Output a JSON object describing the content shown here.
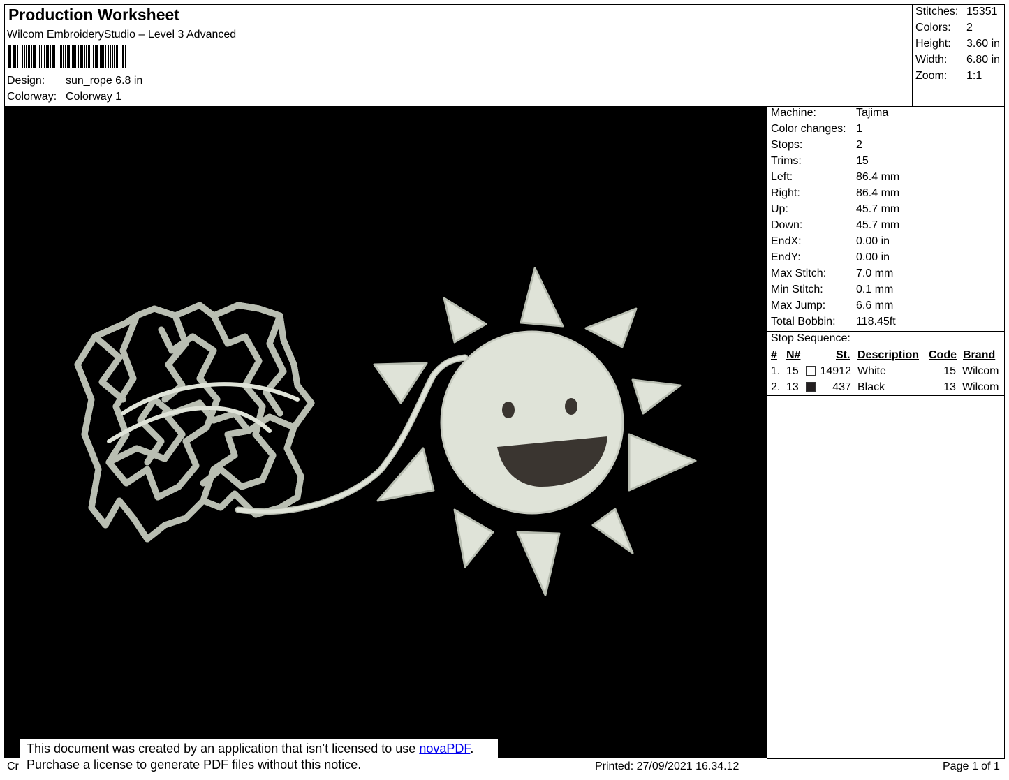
{
  "header": {
    "title": "Production Worksheet",
    "software": "Wilcom EmbroideryStudio – Level 3 Advanced",
    "design_label": "Design:",
    "design_value": "sun_rope 6.8 in",
    "colorway_label": "Colorway:",
    "colorway_value": "Colorway 1"
  },
  "stats": {
    "stitches_label": "Stitches:",
    "stitches": "15351",
    "colors_label": "Colors:",
    "colors": "2",
    "height_label": "Height:",
    "height": "3.60 in",
    "width_label": "Width:",
    "width": "6.80 in",
    "zoom_label": "Zoom:",
    "zoom": "1:1"
  },
  "machine_info": [
    {
      "label": "Machine:",
      "value": "Tajima"
    },
    {
      "label": "Color changes:",
      "value": "1"
    },
    {
      "label": "Stops:",
      "value": "2"
    },
    {
      "label": "Trims:",
      "value": "15"
    },
    {
      "label": "Left:",
      "value": "86.4 mm"
    },
    {
      "label": "Right:",
      "value": "86.4 mm"
    },
    {
      "label": "Up:",
      "value": "45.7 mm"
    },
    {
      "label": "Down:",
      "value": "45.7 mm"
    },
    {
      "label": "EndX:",
      "value": "0.00 in"
    },
    {
      "label": "EndY:",
      "value": "0.00 in"
    },
    {
      "label": "Max Stitch:",
      "value": "7.0 mm"
    },
    {
      "label": "Min Stitch:",
      "value": "0.1 mm"
    },
    {
      "label": "Max Jump:",
      "value": "6.6 mm"
    },
    {
      "label": "Total Bobbin:",
      "value": "118.45ft"
    }
  ],
  "stop_sequence": {
    "title": "Stop Sequence:",
    "headers": {
      "num": "#",
      "n": "N#",
      "st": "St.",
      "desc": "Description",
      "code": "Code",
      "brand": "Brand"
    },
    "rows": [
      {
        "num": "1.",
        "n": "15",
        "swatch": "#ffffff",
        "st": "14912",
        "desc": "White",
        "code": "15",
        "brand": "Wilcom"
      },
      {
        "num": "2.",
        "n": "13",
        "swatch": "#231f20",
        "st": "437",
        "desc": "Black",
        "code": "13",
        "brand": "Wilcom"
      }
    ]
  },
  "design_colors": {
    "thread": "#dfe3d8",
    "thread_shade": "#b9beb2",
    "mouth": "#3a3530",
    "background": "#000000"
  },
  "notice": {
    "line1_prefix": "This document was created by an application that isn’t licensed to use ",
    "link": "novaPDF",
    "line1_suffix": ".",
    "line2": "Purchase a license to generate PDF files without this notice."
  },
  "footer": {
    "left": "Cr",
    "printed": "Printed: 27/09/2021 16.34.12",
    "page": "Page 1 of 1"
  }
}
